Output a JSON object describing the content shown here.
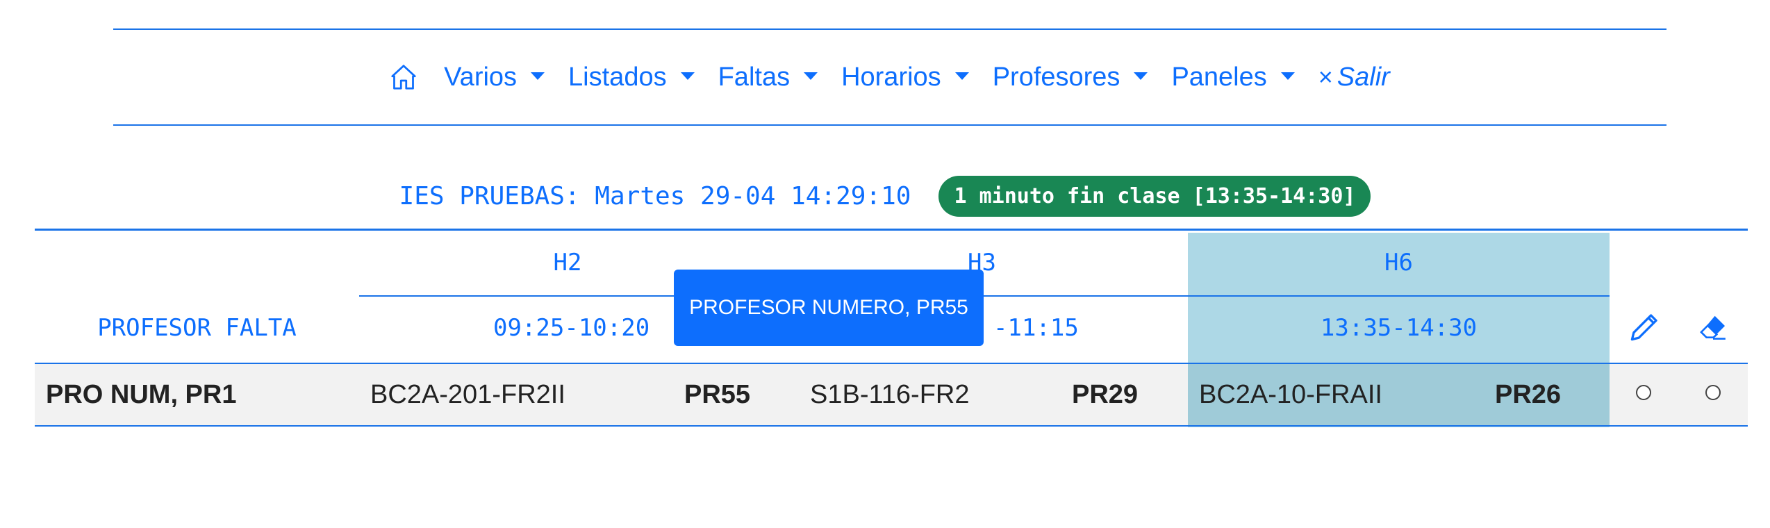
{
  "nav": {
    "items": [
      {
        "label": "Varios"
      },
      {
        "label": "Listados"
      },
      {
        "label": "Faltas"
      },
      {
        "label": "Horarios"
      },
      {
        "label": "Profesores"
      },
      {
        "label": "Paneles"
      }
    ],
    "salir_symbol": "×",
    "salir_label": "Salir"
  },
  "status": {
    "text": "IES PRUEBAS: Martes 29-04 14:29:10",
    "badge": "1 minuto fin clase [13:35-14:30]"
  },
  "table": {
    "header_profesor": "PROFESOR FALTA",
    "columns": [
      {
        "hour": "H2",
        "time": "09:25-10:20"
      },
      {
        "hour": "H3",
        "time": "-11:15"
      },
      {
        "hour": "H6",
        "time": "13:35-14:30"
      }
    ],
    "row": {
      "profesor": "PRO NUM, PR1",
      "cells": [
        {
          "group": "BC2A-201-FR2II",
          "code": "PR55"
        },
        {
          "group": "S1B-116-FR2",
          "code": "PR29"
        },
        {
          "group": "BC2A-10-FRAII",
          "code": "PR26"
        }
      ]
    }
  },
  "tooltip": {
    "text": "PROFESOR NUMERO, PR55"
  },
  "icons": {
    "home": "house-icon",
    "edit": "pencil-icon",
    "erase": "eraser-icon"
  },
  "colors": {
    "accent": "#0d6efd",
    "badge": "#198754",
    "highlight": "#add8e6"
  }
}
